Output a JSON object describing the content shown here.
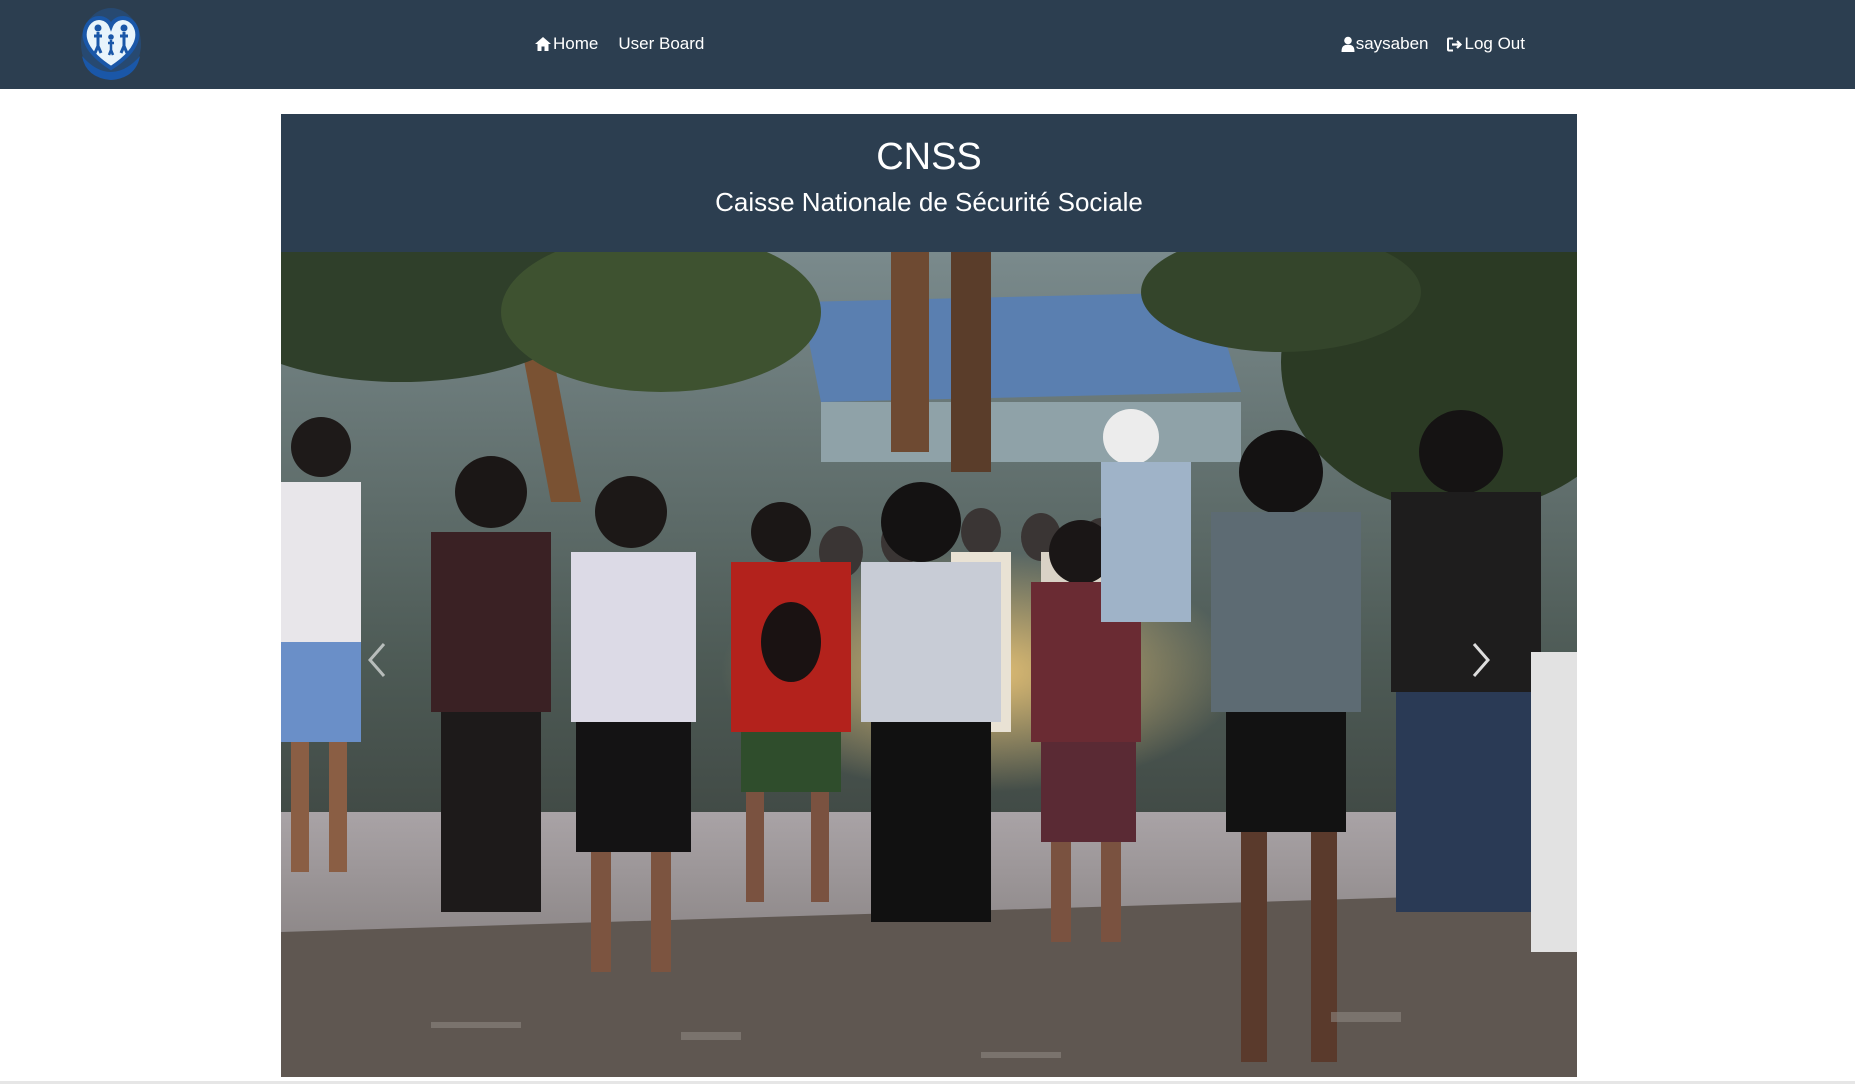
{
  "navbar": {
    "logo_icon": "family-heart-logo-icon",
    "links": [
      {
        "label": "Home",
        "icon": "home-icon"
      },
      {
        "label": "User Board"
      }
    ],
    "user": {
      "label": "saysaben",
      "icon": "user-icon"
    },
    "logout": {
      "label": "Log Out",
      "icon": "logout-icon"
    }
  },
  "banner": {
    "title": "CNSS",
    "subtitle": "Caisse Nationale de Sécurité Sociale"
  },
  "carousel": {
    "image": "photo of a crowd gathered around candles at dusk",
    "prev_icon": "chevron-left-icon",
    "next_icon": "chevron-right-icon"
  },
  "colors": {
    "navbar_bg": "#2c3e50",
    "page_bg": "#ffffff",
    "text": "#ffffff"
  }
}
